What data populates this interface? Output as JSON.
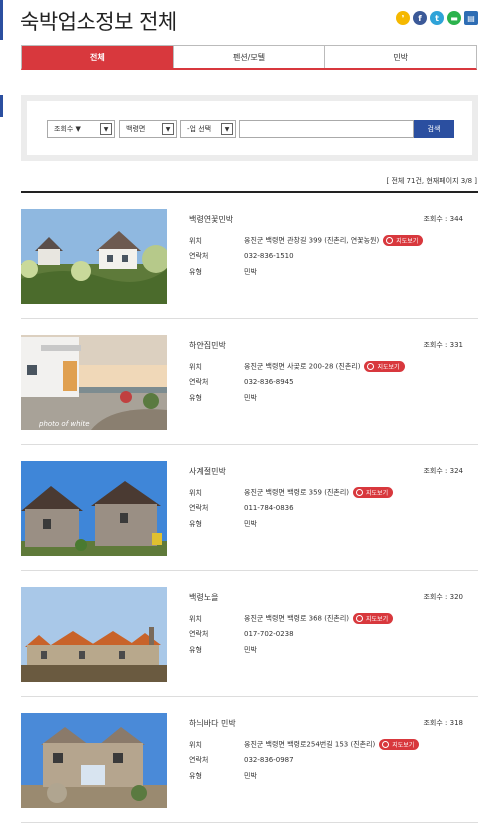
{
  "header": {
    "title": "숙박업소정보 전체",
    "share_icons": [
      "kakaostory-icon",
      "facebook-icon",
      "twitter-icon",
      "line-icon",
      "print-icon"
    ]
  },
  "tabs": [
    {
      "label": "전체",
      "active": true
    },
    {
      "label": "펜션/모텔",
      "active": false
    },
    {
      "label": "민박",
      "active": false
    }
  ],
  "search": {
    "sort_label": "조회수 ▼",
    "region_label": "백령면",
    "type_label": "-업 선택",
    "query_value": "",
    "button_label": "검색"
  },
  "summary": {
    "total_text": "[ 전체 71건, 현재페이지 3/8 ]"
  },
  "labels": {
    "location": "위치",
    "contact": "연락처",
    "type": "유형",
    "views_prefix": "조회수 : ",
    "map_button": "지도보기"
  },
  "items": [
    {
      "name": "백령연꽃민박",
      "views": "344",
      "location": "옹진군 백령면 관창길 399 (진촌리, 연꽃농원)",
      "contact": "032-836-1510",
      "type": "민박"
    },
    {
      "name": "하얀집민박",
      "views": "331",
      "location": "옹진군 백령면 사곶로 200-28 (진촌리)",
      "contact": "032-836-8945",
      "type": "민박",
      "watermark": "photo of white"
    },
    {
      "name": "사계절민박",
      "views": "324",
      "location": "옹진군 백령면 백령로 359 (진촌리)",
      "contact": "011-784-0836",
      "type": "민박"
    },
    {
      "name": "백령노을",
      "views": "320",
      "location": "옹진군 백령면 백령로 368 (진촌리)",
      "contact": "017-702-0238",
      "type": "민박"
    },
    {
      "name": "하늬바다 민박",
      "views": "318",
      "location": "옹진군 백령면 백령로254번길 153 (진촌리)",
      "contact": "032-836-0987",
      "type": "민박"
    }
  ],
  "colors": {
    "accent_red": "#d8383d",
    "accent_blue": "#2b4fa0"
  }
}
